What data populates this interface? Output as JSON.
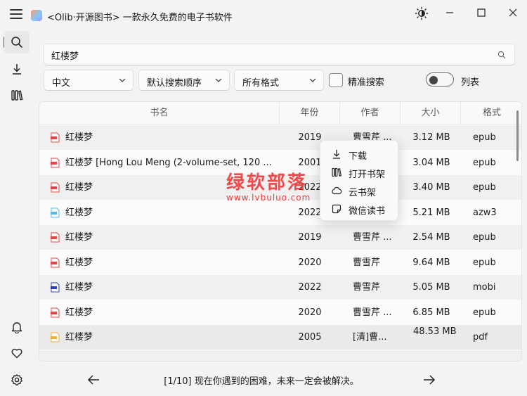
{
  "app": {
    "title": "<Olib·开源图书> 一款永久免费的电子书软件"
  },
  "search": {
    "value": "红楼梦",
    "placeholder": ""
  },
  "filters": {
    "language": "中文",
    "sort": "默认搜索顺序",
    "format": "所有格式",
    "exact_label": "精准搜索",
    "list_label": "列表"
  },
  "table": {
    "headers": [
      "书名",
      "年份",
      "作者",
      "大小",
      "格式"
    ],
    "rows": [
      {
        "name": "红楼梦",
        "year": "2019",
        "author": "曹雪芹 ...",
        "size": "3.12 MB",
        "format": "epub",
        "icon_color": "#e04848"
      },
      {
        "name": "红楼梦 [Hong Lou Meng (2-volume-set, 120 ...",
        "year": "2001",
        "author": "",
        "size": "3.04 MB",
        "format": "epub",
        "icon_color": "#e04848"
      },
      {
        "name": "红楼梦",
        "year": "2022",
        "author": "",
        "size": "3.40 MB",
        "format": "epub",
        "icon_color": "#e04848"
      },
      {
        "name": "红楼梦",
        "year": "2022",
        "author": "",
        "size": "5.21 MB",
        "format": "azw3",
        "icon_color": "#58b8e8"
      },
      {
        "name": "红楼梦",
        "year": "2019",
        "author": "曹雪芹 ...",
        "size": "2.54 MB",
        "format": "epub",
        "icon_color": "#e04848"
      },
      {
        "name": "红楼梦",
        "year": "2020",
        "author": "曹雪芹",
        "size": "9.64 MB",
        "format": "epub",
        "icon_color": "#e04848"
      },
      {
        "name": "红楼梦",
        "year": "2022",
        "author": "曹雪芹",
        "size": "5.05 MB",
        "format": "mobi",
        "icon_color": "#2f3fb8"
      },
      {
        "name": "红楼梦",
        "year": "2020",
        "author": "曹雪芹 ...",
        "size": "6.85 MB",
        "format": "epub",
        "icon_color": "#e04848"
      },
      {
        "name": "红楼梦",
        "year": "2005",
        "author": "[清]曹...",
        "size": "48.53 MB",
        "format": "pdf",
        "icon_color": "#f0b03c"
      }
    ]
  },
  "context_menu": {
    "items": [
      {
        "label": "下载",
        "icon": "download-icon"
      },
      {
        "label": "打开书架",
        "icon": "bookshelf-icon"
      },
      {
        "label": "云书架",
        "icon": "cloud-icon"
      },
      {
        "label": "微信读书",
        "icon": "note-icon"
      }
    ]
  },
  "watermark": {
    "text": "绿软部落",
    "url": "www.lvbuluo.com"
  },
  "footer": {
    "message": "[1/10] 现在你遇到的困难，未来一定会被解决。"
  },
  "colors": {
    "accent": "#00739c",
    "watermark": "#ee3b3b"
  }
}
